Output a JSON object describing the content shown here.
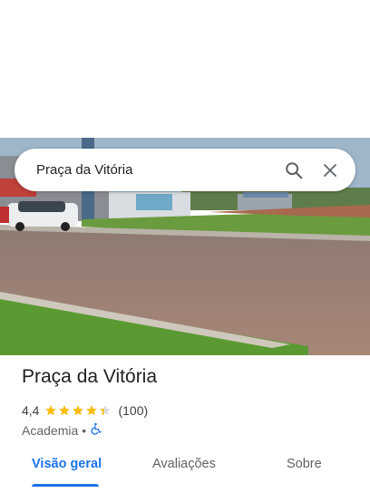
{
  "search": {
    "query": "Praça da Vitória"
  },
  "icons": {
    "search": "search-icon",
    "close": "close-icon",
    "accessibility": "wheelchair-icon",
    "star": "star-icon"
  },
  "place": {
    "name": "Praça da Vitória",
    "rating": "4,4",
    "rating_value": 4.4,
    "reviews": "(100)",
    "category": "Academia",
    "separator": "•"
  },
  "tabs": [
    {
      "label": "Visão geral",
      "active": true
    },
    {
      "label": "Avaliações",
      "active": false
    },
    {
      "label": "Sobre",
      "active": false
    }
  ],
  "colors": {
    "accent": "#1a73e8",
    "star": "#fbbc04",
    "text": "#202124"
  }
}
